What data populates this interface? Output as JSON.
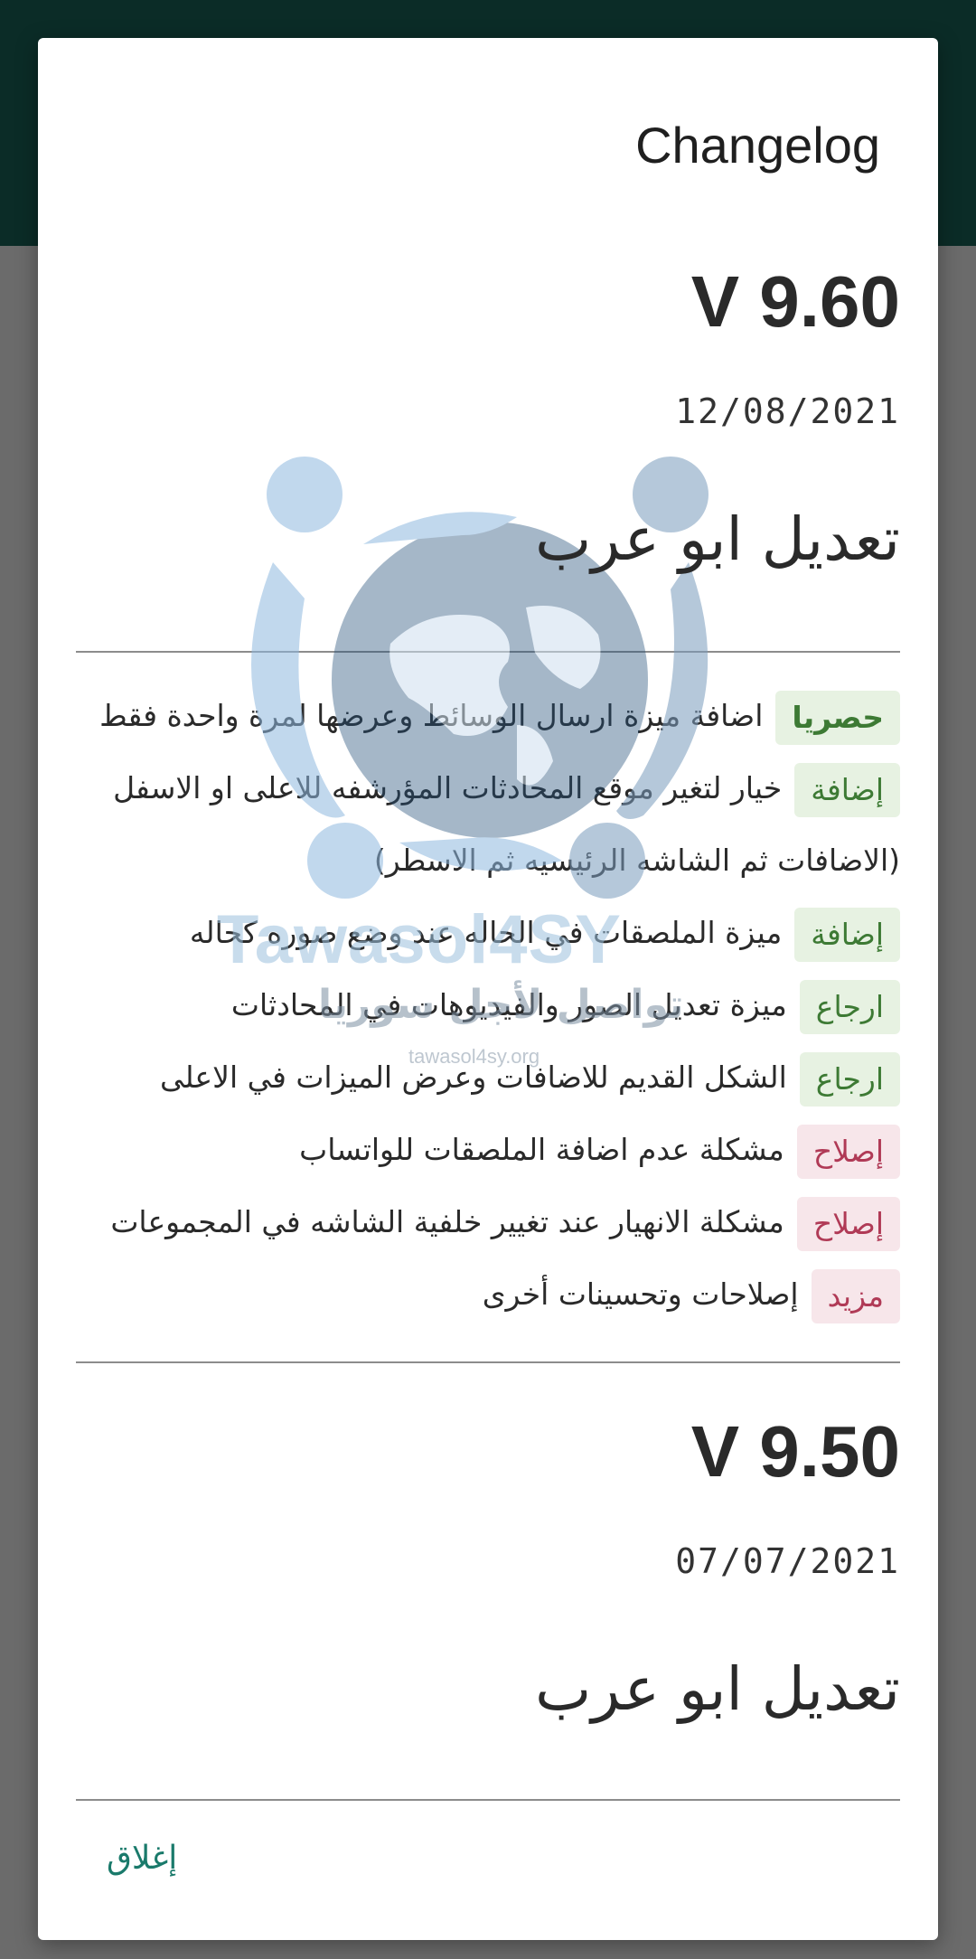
{
  "dialog": {
    "title": "Changelog",
    "close_label": "إغلاق"
  },
  "watermark": {
    "latin": "Tawasol4SY",
    "arabic": "تواصل لأجل سوريا",
    "url": "tawasol4sy.org"
  },
  "releases": [
    {
      "version": "V 9.60",
      "date": "12/08/2021",
      "author": "تعديل ابو عرب",
      "changes": [
        {
          "tag": "حصريا",
          "tag_color": "#3d7a34",
          "text": "اضافة ميزة ارسال الوسائط وعرضها لمرة واحدة فقط"
        },
        {
          "tag": "إضافة",
          "tag_color": "#3d7a34",
          "text": "خيار لتغير موقع المحادثات المؤرشفه للاعلى او الاسفل (الاضافات ثم الشاشه الرئيسيه ثم الاسطر)"
        },
        {
          "tag": "إضافة",
          "tag_color": "#3d7a34",
          "text": "ميزة الملصقات في الحاله عند وضع صوره كحاله"
        },
        {
          "tag": "ارجاع",
          "tag_color": "#3d7a34",
          "text": "ميزة تعديل الصور والفيديوهات في المحادثات"
        },
        {
          "tag": "ارجاع",
          "tag_color": "#3d7a34",
          "text": "الشكل القديم للاضافات وعرض الميزات في الاعلى"
        },
        {
          "tag": "إصلاح",
          "tag_color": "#b03a56",
          "text": "مشكلة عدم اضافة الملصقات للواتساب"
        },
        {
          "tag": "إصلاح",
          "tag_color": "#b03a56",
          "text": "مشكلة الانهيار عند تغيير خلفية الشاشه في المجموعات"
        },
        {
          "tag": "مزيد",
          "tag_color": "#b03a56",
          "text": "إصلاحات وتحسينات أخرى"
        }
      ]
    },
    {
      "version": "V 9.50",
      "date": "07/07/2021",
      "author": "تعديل ابو عرب"
    }
  ],
  "colors": {
    "app_bar": "#0b2c27",
    "scrim": "#6b6b6b",
    "dialog_bg": "#ffffff",
    "accent": "#1a7a6b",
    "tag_green_bg": "#e7f2e2",
    "tag_pink_bg": "#f7e6ea"
  }
}
